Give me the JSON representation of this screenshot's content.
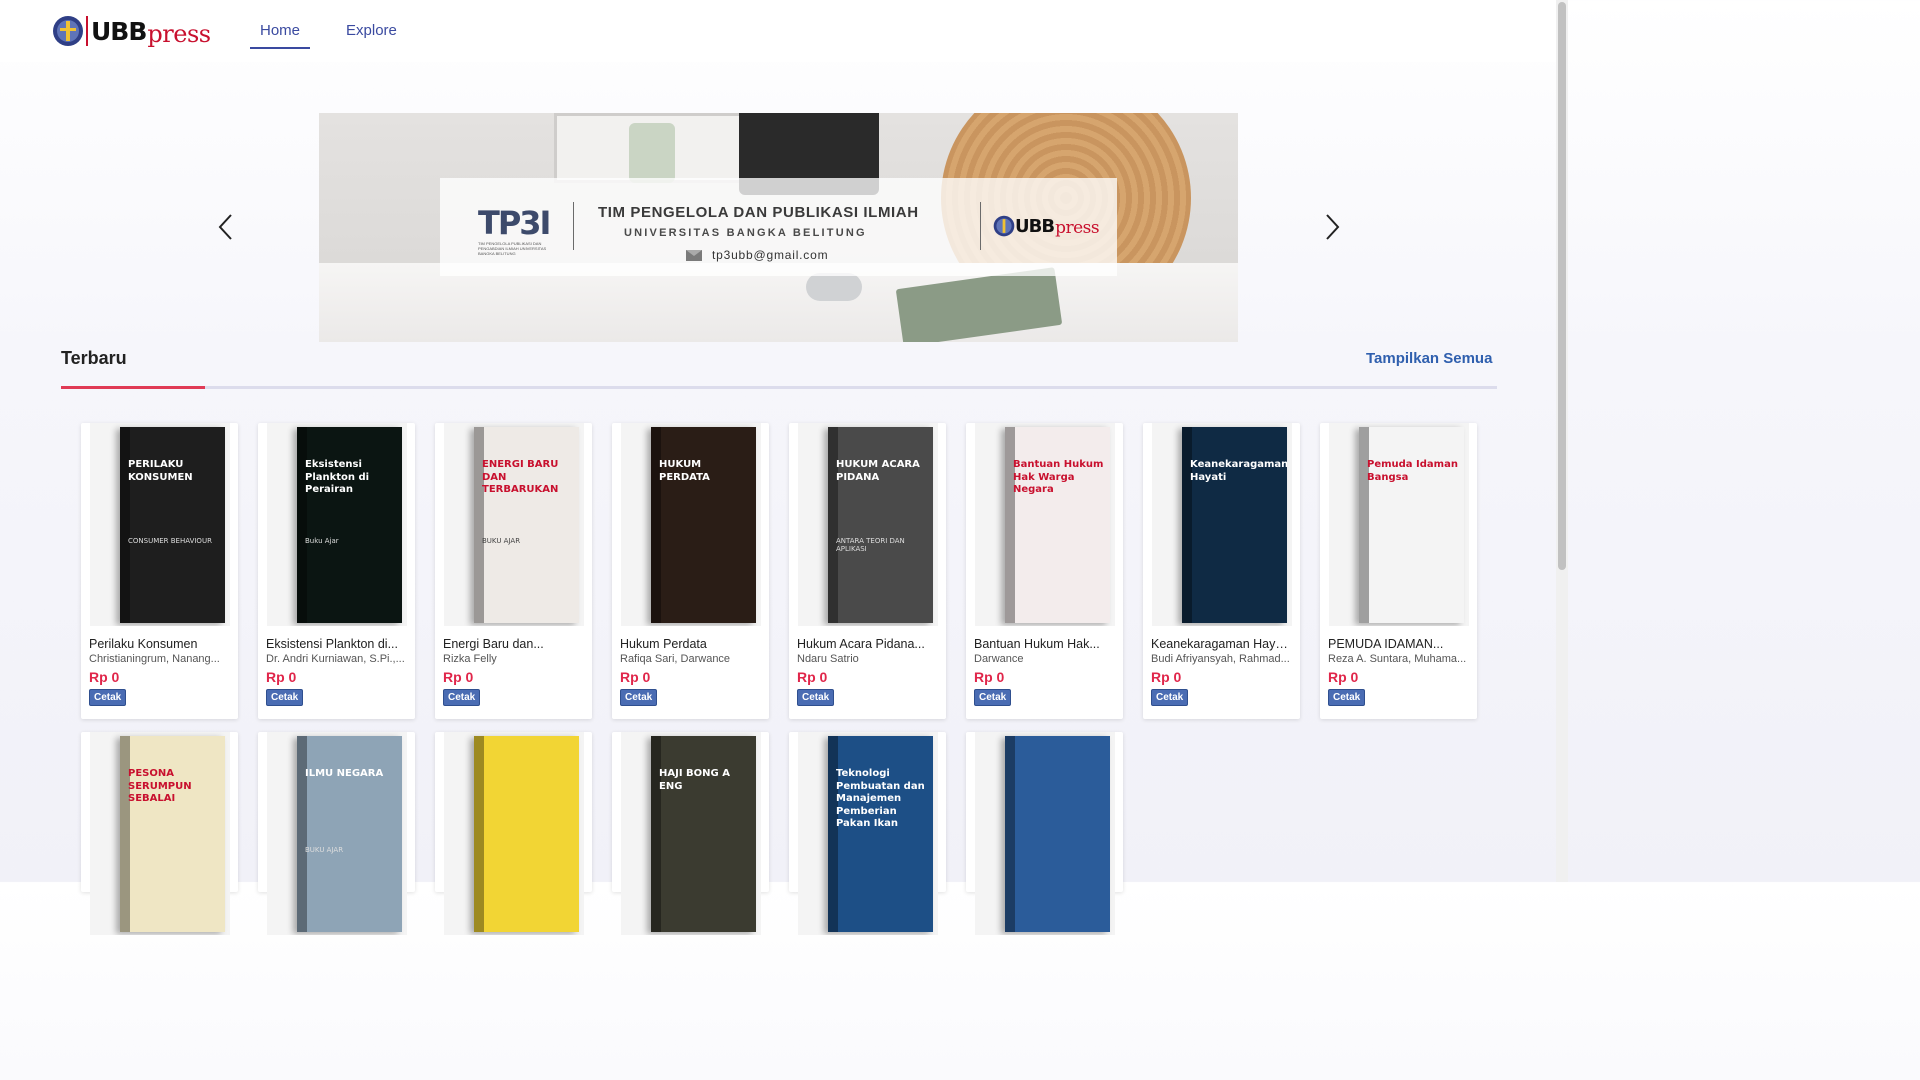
{
  "brand": {
    "ubb": "UBB",
    "press": "press"
  },
  "nav": {
    "home": "Home",
    "explore": "Explore"
  },
  "banner": {
    "tp3": "TP3I",
    "tp3_sub": "TIM PENGELOLA PUBLIKASI DAN PENGABDIAN ILMIAH UNIVERSITAS BANGKA BELITUNG",
    "title": "TIM PENGELOLA DAN PUBLIKASI ILMIAH",
    "subtitle": "UNIVERSITAS BANGKA BELITUNG",
    "email": "tp3ubb@gmail.com"
  },
  "section": {
    "title": "Terbaru",
    "link": "Tampilkan Semua"
  },
  "books_row1": [
    {
      "title": "Perilaku Konsumen",
      "author": "Christianingrum, Nanang...",
      "price": "Rp 0",
      "badge": "Cetak",
      "cover_title": "PERILAKU KONSUMEN",
      "cover_sub": "CONSUMER BEHAVIOUR",
      "bg": "#1e1e1e"
    },
    {
      "title": "Eksistensi Plankton di...",
      "author": "Dr. Andri Kurniawan, S.Pi.,...",
      "price": "Rp 0",
      "badge": "Cetak",
      "cover_title": "Eksistensi Plankton di Perairan",
      "cover_sub": "Buku Ajar",
      "bg": "#0b1512"
    },
    {
      "title": "Energi Baru dan...",
      "author": "Rizka Felly",
      "price": "Rp 0",
      "badge": "Cetak",
      "cover_title": "ENERGI BARU DAN TERBARUKAN",
      "cover_sub": "BUKU AJAR",
      "bg": "#eeeae6"
    },
    {
      "title": "Hukum Perdata",
      "author": "Rafiqa Sari, Darwance",
      "price": "Rp 0",
      "badge": "Cetak",
      "cover_title": "HUKUM PERDATA",
      "cover_sub": "",
      "bg": "#2a1d16"
    },
    {
      "title": "Hukum Acara Pidana...",
      "author": "Ndaru Satrio",
      "price": "Rp 0",
      "badge": "Cetak",
      "cover_title": "HUKUM ACARA PIDANA",
      "cover_sub": "ANTARA TEORI DAN APLIKASI",
      "bg": "#4a4a4a"
    },
    {
      "title": "Bantuan Hukum Hak...",
      "author": "Darwance",
      "price": "Rp 0",
      "badge": "Cetak",
      "cover_title": "Bantuan Hukum Hak Warga Negara",
      "cover_sub": "",
      "bg": "#f3ecec"
    },
    {
      "title": "Keanekaragaman Hayat...",
      "author": "Budi Afriyansyah, Rahmad...",
      "price": "Rp 0",
      "badge": "Cetak",
      "cover_title": "Keanekaragaman Hayati",
      "cover_sub": "",
      "bg": "#0f2a44"
    },
    {
      "title": "PEMUDA IDAMAN...",
      "author": "Reza A. Suntara, Muhama...",
      "price": "Rp 0",
      "badge": "Cetak",
      "cover_title": "Pemuda Idaman Bangsa",
      "cover_sub": "",
      "bg": "#f4f4f4"
    }
  ],
  "books_row2": [
    {
      "cover_title": "PESONA SERUMPUN SEBALAI",
      "cover_sub": "",
      "bg": "#efe6c4"
    },
    {
      "cover_title": "ILMU NEGARA",
      "cover_sub": "BUKU AJAR",
      "bg": "#8ea4b6"
    },
    {
      "cover_title": "",
      "cover_sub": "",
      "bg": "#f2d534"
    },
    {
      "cover_title": "HAJI BONG A ENG",
      "cover_sub": "",
      "bg": "#3b3b30"
    },
    {
      "cover_title": "Teknologi Pembuatan dan Manajemen Pemberian Pakan Ikan",
      "cover_sub": "",
      "bg": "#1d4f86"
    },
    {
      "cover_title": "",
      "cover_sub": "",
      "bg": "#2b5c9a"
    }
  ],
  "colors": {
    "accent": "#e03a55",
    "link": "#2f5fae",
    "nav": "#3a4aa0",
    "price": "#e0264a",
    "badge": "#4a6cb3"
  },
  "icons": {
    "prev": "chevron-left-icon",
    "next": "chevron-right-icon",
    "mail": "mail-icon"
  }
}
